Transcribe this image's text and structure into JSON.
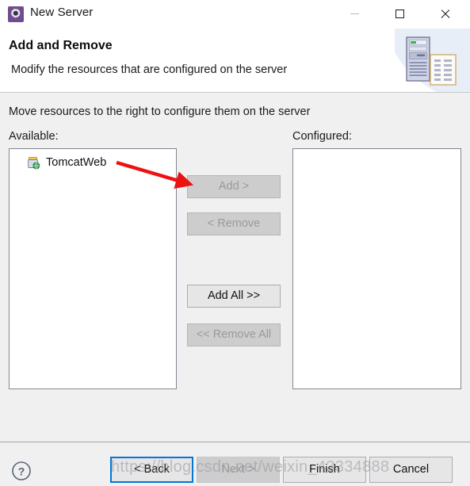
{
  "window": {
    "title": "New Server",
    "icon": "server-gear-icon",
    "controls": {
      "minimize": "minimize-icon",
      "maximize": "maximize-icon",
      "close": "close-icon"
    }
  },
  "header": {
    "title": "Add and Remove",
    "description": "Modify the resources that are configured on the server",
    "art_icon": "server-and-document-icon"
  },
  "body": {
    "instruction": "Move resources to the right to configure them on the server",
    "available": {
      "label": "Available:",
      "items": [
        {
          "name": "TomcatWeb",
          "icon": "web-module-icon"
        }
      ]
    },
    "configured": {
      "label": "Configured:",
      "items": []
    },
    "transfer_buttons": [
      {
        "label": "Add >",
        "enabled": false
      },
      {
        "label": "< Remove",
        "enabled": false
      },
      {
        "label": "Add All >>",
        "enabled": true
      },
      {
        "label": "<< Remove All",
        "enabled": false
      }
    ]
  },
  "footer": {
    "help": "?",
    "back": "< Back",
    "next": "Next >",
    "finish": "Finish",
    "cancel": "Cancel"
  },
  "watermark": {
    "text": "https://blog.csdn.net/weixin_43334888"
  },
  "colors": {
    "accent_focus": "#0078d7",
    "dialog_background": "#f0f0f0",
    "header_background": "#ffffff",
    "button_enabled": "#e6e6e6",
    "button_disabled": "#cdcdcd",
    "disabled_text": "#9a9a9a",
    "annotation_arrow": "#ee1111",
    "app_icon": "#6f4d8e"
  }
}
